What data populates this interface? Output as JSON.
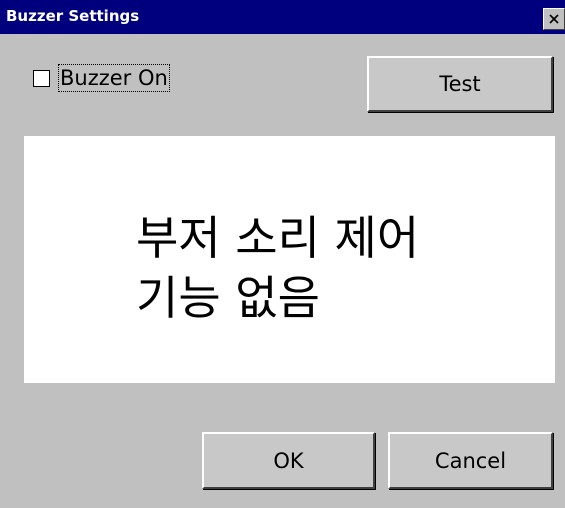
{
  "window": {
    "title": "Buzzer Settings",
    "close_symbol": "×"
  },
  "controls": {
    "buzzer_checkbox_label": "Buzzer On",
    "buzzer_checked": false,
    "test_label": "Test"
  },
  "message": {
    "text": "부저 소리 제어\n기능 없음"
  },
  "footer": {
    "ok_label": "OK",
    "cancel_label": "Cancel"
  },
  "icons": {
    "close": "close-icon",
    "checkbox": "checkbox-icon"
  },
  "colors": {
    "titlebar": "#00007f",
    "title_text": "#ffffff",
    "dialog_bg": "#c0c0c0",
    "panel_bg": "#ffffff"
  }
}
